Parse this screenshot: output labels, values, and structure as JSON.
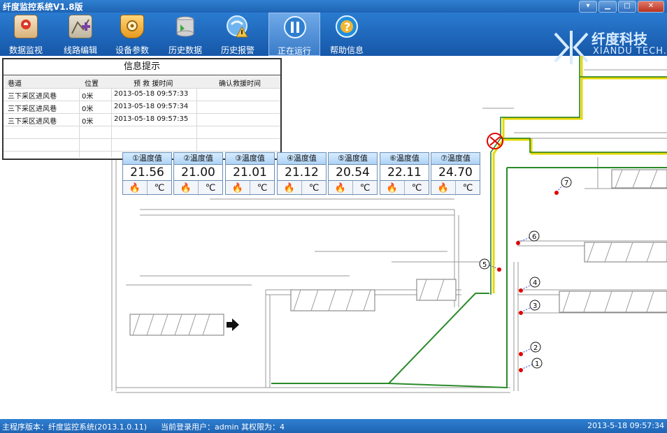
{
  "window": {
    "title": "纤度监控系统V1.8版"
  },
  "toolbar": {
    "items": [
      {
        "label": "数据监视",
        "icon": "map-icon",
        "active": false
      },
      {
        "label": "线路编辑",
        "icon": "route-edit-icon",
        "active": false
      },
      {
        "label": "设备参数",
        "icon": "settings-icon",
        "active": false
      },
      {
        "label": "历史数据",
        "icon": "database-icon",
        "active": false
      },
      {
        "label": "历史报警",
        "icon": "alarm-icon",
        "active": false
      },
      {
        "label": "正在运行",
        "icon": "pause-icon",
        "active": true
      },
      {
        "label": "帮助信息",
        "icon": "help-icon",
        "active": false
      }
    ]
  },
  "logo": {
    "name": "纤度科技",
    "subtitle": "XIANDU TECH."
  },
  "info_panel": {
    "title": "信息提示",
    "columns": [
      "巷道",
      "位置",
      "预 救 援时间",
      "确认救援时间"
    ],
    "rows": [
      [
        "三下采区进风巷",
        "0米",
        "2013-05-18 09:57:33",
        ""
      ],
      [
        "三下采区进风巷",
        "0米",
        "2013-05-18 09:57:34",
        ""
      ],
      [
        "三下采区进风巷",
        "0米",
        "2013-05-18 09:57:35",
        ""
      ]
    ]
  },
  "sensors": [
    {
      "label": "①温度值",
      "value": "21.56",
      "unit": "℃"
    },
    {
      "label": "②温度值",
      "value": "21.00",
      "unit": "℃"
    },
    {
      "label": "③温度值",
      "value": "21.01",
      "unit": "℃"
    },
    {
      "label": "④温度值",
      "value": "21.12",
      "unit": "℃"
    },
    {
      "label": "⑤温度值",
      "value": "20.54",
      "unit": "℃"
    },
    {
      "label": "⑥温度值",
      "value": "22.11",
      "unit": "℃"
    },
    {
      "label": "⑦温度值",
      "value": "24.70",
      "unit": "℃"
    }
  ],
  "map_markers": [
    "1",
    "2",
    "3",
    "4",
    "5",
    "6",
    "7"
  ],
  "status": {
    "version": "主程序版本：纤度监控系统(2013.1.0.11)",
    "user": "当前登录用户：admin 其权限为：4",
    "datetime": "2013-5-18 09:57:34"
  },
  "colors": {
    "titlebar": "#1f64b4",
    "route_green": "#2a8a2a",
    "route_yellow": "#e6d800",
    "alarm_red": "#e00000"
  }
}
